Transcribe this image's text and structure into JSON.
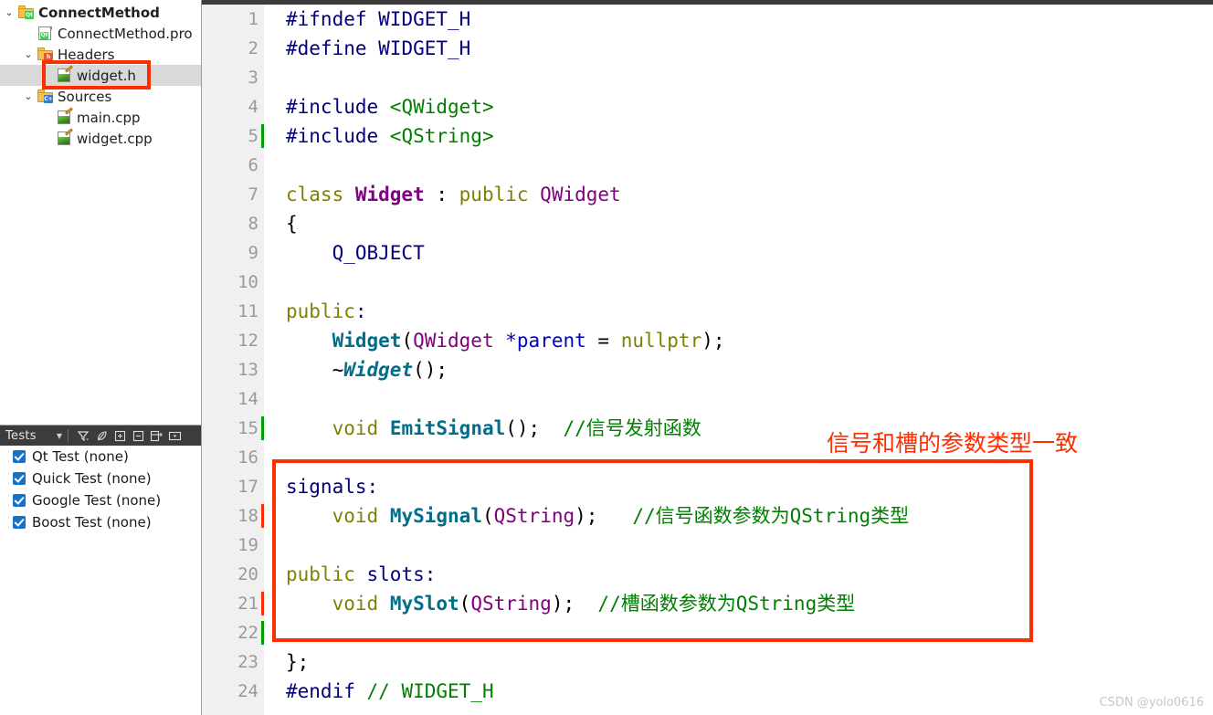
{
  "project_tree": {
    "rows": [
      {
        "label": "ConnectMethod",
        "indent": 0,
        "twisty": "⌄",
        "icon": "folder-qt-icon",
        "bold": true,
        "selected": false
      },
      {
        "label": "ConnectMethod.pro",
        "indent": 1,
        "twisty": "",
        "icon": "file-pro-icon",
        "bold": false,
        "selected": false
      },
      {
        "label": "Headers",
        "indent": 1,
        "twisty": "⌄",
        "icon": "folder-h-icon",
        "bold": false,
        "selected": false
      },
      {
        "label": "widget.h",
        "indent": 2,
        "twisty": "",
        "icon": "file-source-icon",
        "bold": false,
        "selected": true
      },
      {
        "label": "Sources",
        "indent": 1,
        "twisty": "⌄",
        "icon": "folder-cpp-icon",
        "bold": false,
        "selected": false
      },
      {
        "label": "main.cpp",
        "indent": 2,
        "twisty": "",
        "icon": "file-source-icon",
        "bold": false,
        "selected": false
      },
      {
        "label": "widget.cpp",
        "indent": 2,
        "twisty": "",
        "icon": "file-source-icon",
        "bold": false,
        "selected": false
      }
    ]
  },
  "tests_panel": {
    "title": "Tests",
    "toolbar_icons": [
      "filter-icon",
      "leaf-icon",
      "expand-all-icon",
      "collapse-all-icon",
      "expand-node-icon",
      "options-icon"
    ],
    "items": [
      {
        "label": "Qt Test (none)",
        "checked": true
      },
      {
        "label": "Quick Test (none)",
        "checked": true
      },
      {
        "label": "Google Test (none)",
        "checked": true
      },
      {
        "label": "Boost Test (none)",
        "checked": true
      }
    ]
  },
  "editor": {
    "lines": [
      {
        "num": "1",
        "fold": false,
        "marker": "none",
        "tokens": [
          {
            "t": "#ifndef ",
            "c": "pp"
          },
          {
            "t": "WIDGET_H",
            "c": "macroname"
          }
        ]
      },
      {
        "num": "2",
        "fold": false,
        "marker": "none",
        "tokens": [
          {
            "t": "#define ",
            "c": "pp"
          },
          {
            "t": "WIDGET_H",
            "c": "macroname"
          }
        ]
      },
      {
        "num": "3",
        "fold": false,
        "marker": "none",
        "tokens": []
      },
      {
        "num": "4",
        "fold": false,
        "marker": "none",
        "tokens": [
          {
            "t": "#include ",
            "c": "pp"
          },
          {
            "t": "<QWidget>",
            "c": "str"
          }
        ]
      },
      {
        "num": "5",
        "fold": false,
        "marker": "green",
        "tokens": [
          {
            "t": "#include ",
            "c": "pp"
          },
          {
            "t": "<QString>",
            "c": "str"
          }
        ]
      },
      {
        "num": "6",
        "fold": false,
        "marker": "none",
        "tokens": []
      },
      {
        "num": "7",
        "fold": true,
        "marker": "none",
        "tokens": [
          {
            "t": "class ",
            "c": "kw"
          },
          {
            "t": "Widget",
            "c": "cls"
          },
          {
            "t": " : ",
            "c": ""
          },
          {
            "t": "public",
            "c": "kw"
          },
          {
            "t": " ",
            "c": ""
          },
          {
            "t": "QWidget",
            "c": "type"
          }
        ]
      },
      {
        "num": "8",
        "fold": false,
        "marker": "none",
        "tokens": [
          {
            "t": "{",
            "c": ""
          }
        ]
      },
      {
        "num": "9",
        "fold": false,
        "marker": "none",
        "tokens": [
          {
            "t": "    Q_OBJECT",
            "c": "qobj"
          }
        ]
      },
      {
        "num": "10",
        "fold": false,
        "marker": "none",
        "tokens": []
      },
      {
        "num": "11",
        "fold": false,
        "marker": "none",
        "tokens": [
          {
            "t": "public",
            "c": "kw"
          },
          {
            "t": ":",
            "c": "acc"
          }
        ]
      },
      {
        "num": "12",
        "fold": false,
        "marker": "none",
        "tokens": [
          {
            "t": "    ",
            "c": ""
          },
          {
            "t": "Widget",
            "c": "func"
          },
          {
            "t": "(",
            "c": ""
          },
          {
            "t": "QWidget",
            "c": "type"
          },
          {
            "t": " ",
            "c": ""
          },
          {
            "t": "*parent",
            "c": "var"
          },
          {
            "t": " = ",
            "c": ""
          },
          {
            "t": "nullptr",
            "c": "kw"
          },
          {
            "t": ");",
            "c": ""
          }
        ]
      },
      {
        "num": "13",
        "fold": false,
        "marker": "none",
        "tokens": [
          {
            "t": "    ~",
            "c": ""
          },
          {
            "t": "Widget",
            "c": "funcital"
          },
          {
            "t": "();",
            "c": ""
          }
        ]
      },
      {
        "num": "14",
        "fold": false,
        "marker": "none",
        "tokens": []
      },
      {
        "num": "15",
        "fold": false,
        "marker": "green",
        "tokens": [
          {
            "t": "    ",
            "c": ""
          },
          {
            "t": "void",
            "c": "kw"
          },
          {
            "t": " ",
            "c": ""
          },
          {
            "t": "EmitSignal",
            "c": "func"
          },
          {
            "t": "();  ",
            "c": ""
          },
          {
            "t": "//信号发射函数",
            "c": "cmt"
          }
        ]
      },
      {
        "num": "16",
        "fold": false,
        "marker": "none",
        "tokens": []
      },
      {
        "num": "17",
        "fold": false,
        "marker": "none",
        "tokens": [
          {
            "t": "signals",
            "c": "acc"
          },
          {
            "t": ":",
            "c": "acc"
          }
        ]
      },
      {
        "num": "18",
        "fold": false,
        "marker": "red",
        "tokens": [
          {
            "t": "    ",
            "c": ""
          },
          {
            "t": "void",
            "c": "kw"
          },
          {
            "t": " ",
            "c": ""
          },
          {
            "t": "MySignal",
            "c": "func"
          },
          {
            "t": "(",
            "c": ""
          },
          {
            "t": "QString",
            "c": "type"
          },
          {
            "t": ");   ",
            "c": ""
          },
          {
            "t": "//信号函数参数为QString类型",
            "c": "cmt"
          }
        ]
      },
      {
        "num": "19",
        "fold": false,
        "marker": "none",
        "tokens": []
      },
      {
        "num": "20",
        "fold": false,
        "marker": "none",
        "tokens": [
          {
            "t": "public",
            "c": "kw"
          },
          {
            "t": " ",
            "c": ""
          },
          {
            "t": "slots",
            "c": "acc"
          },
          {
            "t": ":",
            "c": "acc"
          }
        ]
      },
      {
        "num": "21",
        "fold": false,
        "marker": "red",
        "tokens": [
          {
            "t": "    ",
            "c": ""
          },
          {
            "t": "void",
            "c": "kw"
          },
          {
            "t": " ",
            "c": ""
          },
          {
            "t": "MySlot",
            "c": "func"
          },
          {
            "t": "(",
            "c": ""
          },
          {
            "t": "QString",
            "c": "type"
          },
          {
            "t": ");  ",
            "c": ""
          },
          {
            "t": "//槽函数参数为QString类型",
            "c": "cmt"
          }
        ]
      },
      {
        "num": "22",
        "fold": false,
        "marker": "green",
        "tokens": []
      },
      {
        "num": "23",
        "fold": false,
        "marker": "none",
        "tokens": [
          {
            "t": "};",
            "c": ""
          }
        ]
      },
      {
        "num": "24",
        "fold": false,
        "marker": "none",
        "tokens": [
          {
            "t": "#endif ",
            "c": "pp"
          },
          {
            "t": "// WIDGET_H",
            "c": "cmt"
          }
        ]
      }
    ]
  },
  "annotations": {
    "red_note": "信号和槽的参数类型一致",
    "accent_color": "#ff2d00"
  },
  "watermark": "CSDN @yolo0616"
}
